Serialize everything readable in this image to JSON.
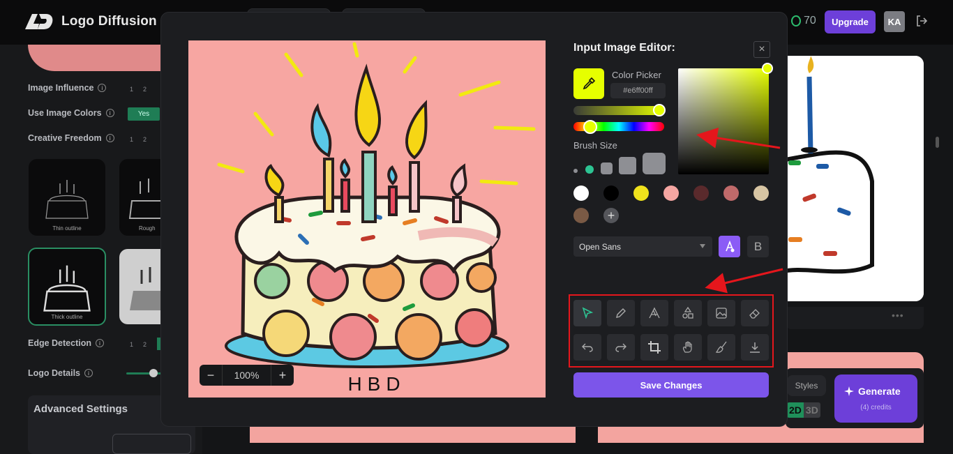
{
  "app": {
    "name": "Logo Diffusion"
  },
  "topbar": {
    "credits": "70",
    "upgrade_label": "Upgrade",
    "avatar_initials": "KA"
  },
  "sidebar": {
    "image_influence_label": "Image Influence",
    "use_image_colors_label": "Use Image Colors",
    "use_image_colors_value": "Yes",
    "creative_freedom_label": "Creative Freedom",
    "edge_detection_label": "Edge Detection",
    "logo_details_label": "Logo Details",
    "advanced_settings_label": "Advanced Settings",
    "scale_numbers": [
      "1",
      "2"
    ],
    "thumbnails": [
      {
        "caption": "Thin outline"
      },
      {
        "caption": "Rough"
      },
      {
        "caption": "Thick outline"
      },
      {
        "caption": ""
      }
    ]
  },
  "main": {
    "styles_label": "Styles",
    "mode_2d": "2D",
    "mode_3d": "3D",
    "generate_label": "Generate",
    "generate_credits": "(4) credits"
  },
  "editor": {
    "title": "Input Image Editor:",
    "close_glyph": "×",
    "color_picker_label": "Color Picker",
    "hex_value": "#e6ff00ff",
    "current_color": "#e6ff00",
    "brush_size_label": "Brush Size",
    "swatches": [
      "#ffffff",
      "#000000",
      "#f0e21c",
      "#f5a6a2",
      "#5a2a2c",
      "#c06a6a",
      "#d7c5a3",
      "#7a5a45"
    ],
    "add_swatch_glyph": "+",
    "font_value": "Open Sans",
    "bold_glyph": "B",
    "zoom_value": "100%",
    "zoom_out_glyph": "−",
    "zoom_in_glyph": "+",
    "save_label": "Save Changes",
    "canvas_text": "HBD",
    "tools_row1": [
      "select-icon",
      "pencil-icon",
      "text-icon",
      "shapes-icon",
      "image-icon",
      "eraser-icon"
    ],
    "tools_row2": [
      "undo-icon",
      "redo-icon",
      "crop-icon",
      "hand-icon",
      "fill-brush-icon",
      "download-icon"
    ]
  }
}
